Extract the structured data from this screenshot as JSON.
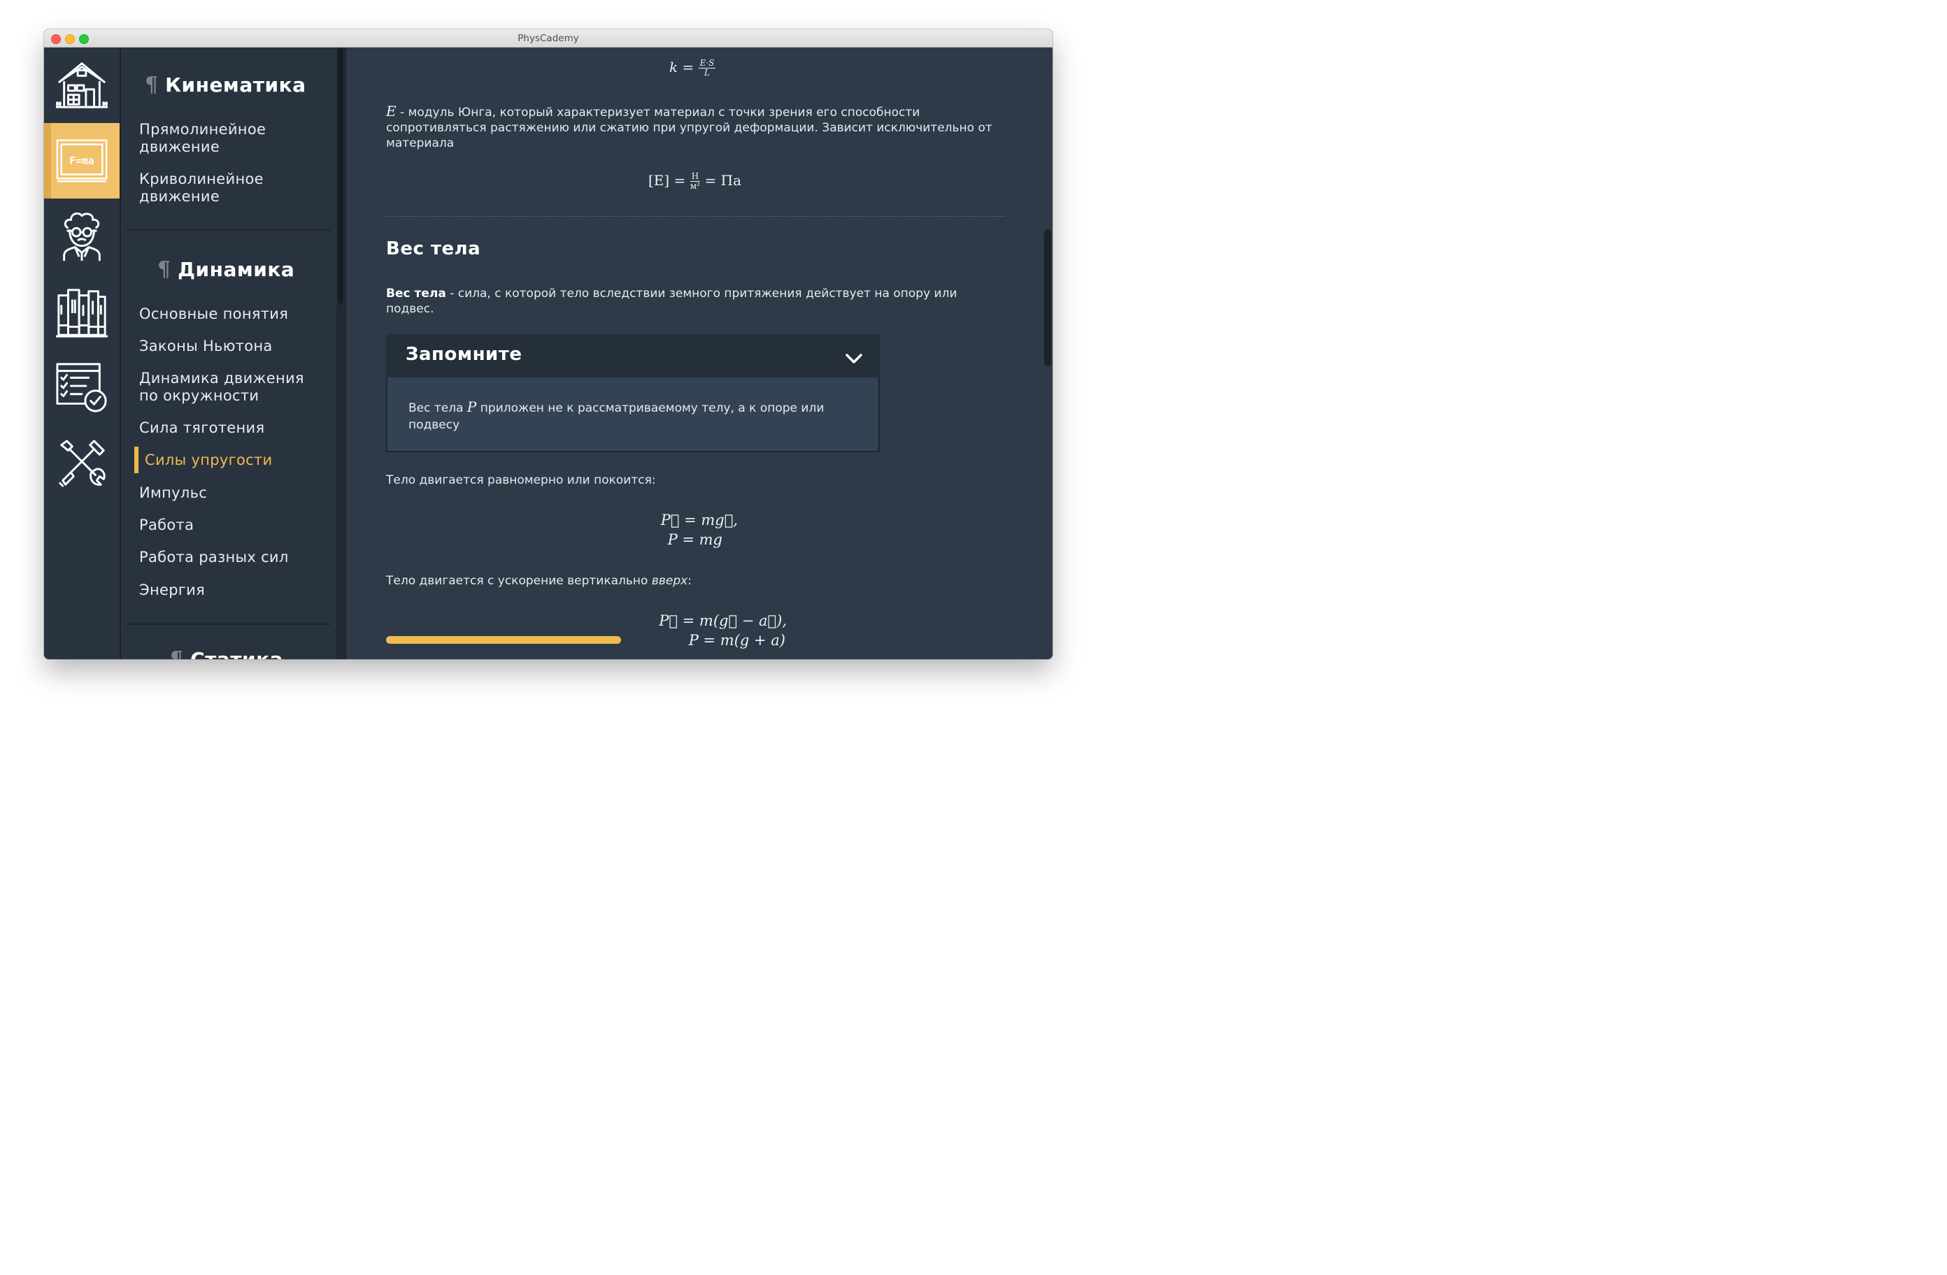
{
  "window": {
    "title": "PhysCademy"
  },
  "colors": {
    "accent": "#f2b84b",
    "rail_active": "#f1c26b",
    "background": "#2e3a47"
  },
  "rail": {
    "items": [
      {
        "icon": "house-icon",
        "active": false
      },
      {
        "icon": "blackboard-formula-icon",
        "label": "F=ma",
        "active": true
      },
      {
        "icon": "scientist-icon",
        "active": false
      },
      {
        "icon": "books-icon",
        "active": false
      },
      {
        "icon": "checklist-icon",
        "active": false
      },
      {
        "icon": "tools-icon",
        "active": false
      }
    ]
  },
  "nav": {
    "pilcrow": "¶",
    "sections": [
      {
        "title": "Кинематика",
        "items": [
          "Прямолинейное движение",
          "Криволинейное движение"
        ]
      },
      {
        "title": "Динамика",
        "items": [
          "Основные понятия",
          "Законы Ньютона",
          "Динамика движения по окружности",
          "Сила тяготения",
          "Силы упругости",
          "Импульс",
          "Работа",
          "Работа разных сил",
          "Энергия"
        ],
        "active_item": "Силы упругости"
      },
      {
        "title": "Статика"
      }
    ]
  },
  "content": {
    "formula_k": {
      "lhs": "k =",
      "num": "E·S",
      "den": "L"
    },
    "e_symbol": "E",
    "e_description": " - модуль Юнга, который характеризует материал с точки зрения его способности сопротивляться растяжению или сжатию при упругой деформации. Зависит исключительно от материала",
    "formula_e": {
      "lhs": "[E] =",
      "num": "Н",
      "den": "м²",
      "rhs": "= Па"
    },
    "section_title": "Вес тела",
    "definition_term": "Вес тела",
    "definition_rest": " - сила, с которой тело вследствии земного притяжения действует на опору или подвес.",
    "remember": {
      "title": "Запомните",
      "text_before": "Вес тела ",
      "symbol": "P",
      "text_after": " приложен не к рассматриваемому телу, а к опоре или подвесу"
    },
    "case1_text": "Тело двигается равномерно или покоится:",
    "case1_eq1": "P⃗ = mg⃗,",
    "case1_eq2": "P = mg",
    "case2_text": "Тело двигается с ускорение вертикально ",
    "case2_emph": "вверх",
    "case2_end": ":",
    "case2_eq1": "P⃗ = m(g⃗ − a⃗),",
    "case2_eq2": "P = m(g + a)",
    "progress": 1.0
  }
}
